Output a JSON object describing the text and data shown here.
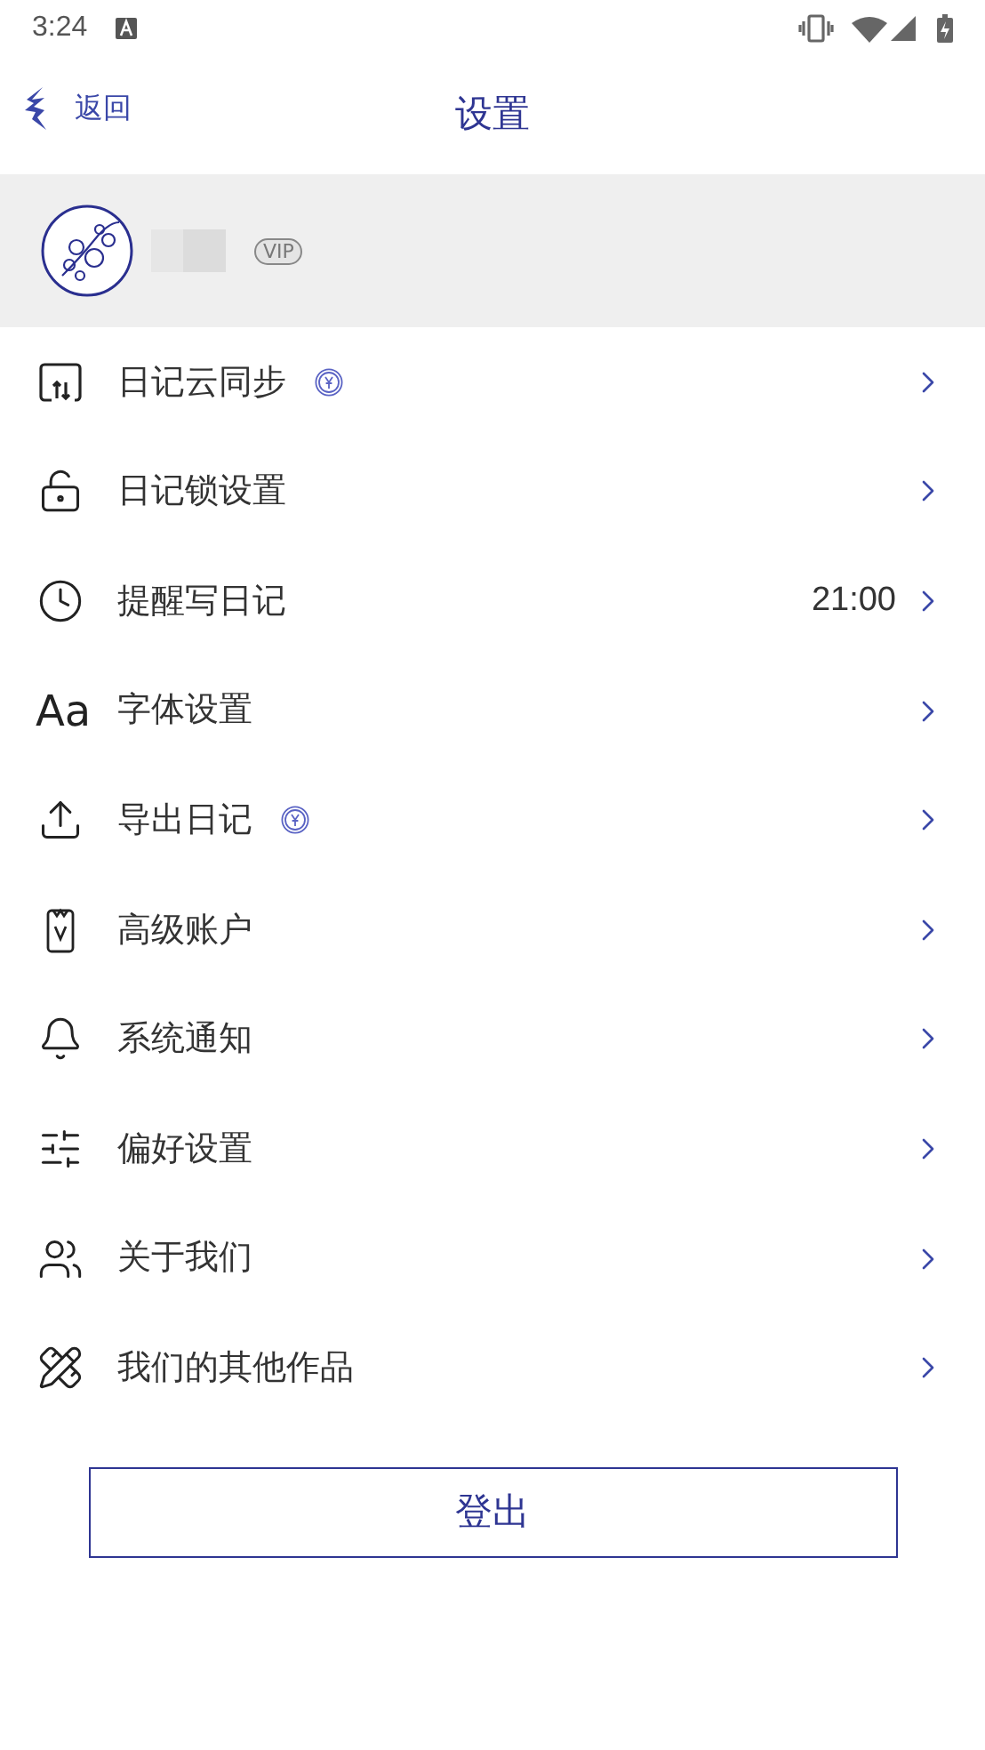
{
  "status_bar": {
    "time": "3:24"
  },
  "nav": {
    "back": "返回",
    "title": "设置"
  },
  "profile": {
    "vip": "VIP"
  },
  "items": [
    {
      "kind": "sync",
      "label": "日记云同步",
      "paid": true
    },
    {
      "kind": "lock",
      "label": "日记锁设置",
      "paid": false
    },
    {
      "kind": "clock",
      "label": "提醒写日记",
      "paid": false,
      "value": "21:00"
    },
    {
      "kind": "font",
      "icon_text": "Aa",
      "label": "字体设置",
      "paid": false
    },
    {
      "kind": "export",
      "label": "导出日记",
      "paid": true
    },
    {
      "kind": "vip",
      "label": "高级账户",
      "paid": false
    },
    {
      "kind": "bell",
      "label": "系统通知",
      "paid": false
    },
    {
      "kind": "sliders",
      "label": "偏好设置",
      "paid": false
    },
    {
      "kind": "users",
      "label": "关于我们",
      "paid": false
    },
    {
      "kind": "tools",
      "label": "我们的其他作品",
      "paid": false
    }
  ],
  "logout": "登出"
}
